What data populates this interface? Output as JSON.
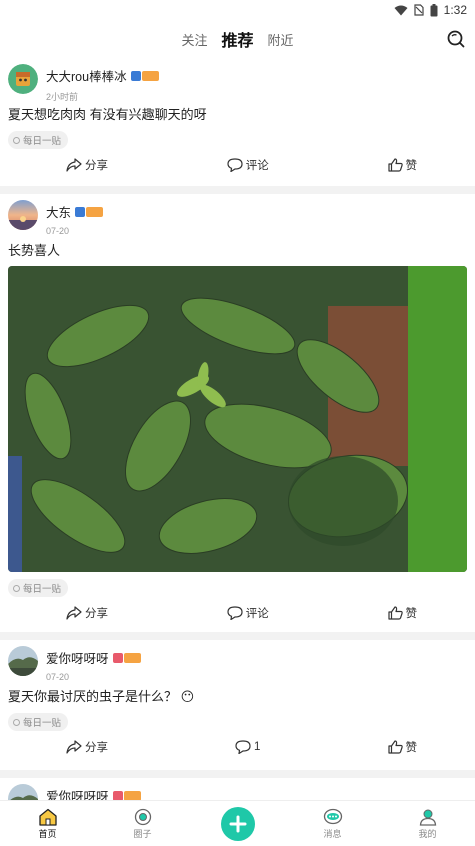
{
  "status_bar": {
    "time": "1:32"
  },
  "top_nav": {
    "tabs": [
      {
        "label": "关注"
      },
      {
        "label": "推荐"
      },
      {
        "label": "附近"
      }
    ]
  },
  "posts": [
    {
      "username": "大大rou棒棒冰",
      "time": "2小时前",
      "text": "夏天想吃肉肉 有没有兴趣聊天的呀",
      "tag": "每日一贴",
      "share": "分享",
      "comment": "评论",
      "like": "赞"
    },
    {
      "username": "大东",
      "time": "07-20",
      "text": "长势喜人",
      "tag": "每日一贴",
      "share": "分享",
      "comment": "评论",
      "like": "赞"
    },
    {
      "username": "爱你呀呀呀",
      "time": "07-20",
      "text": "夏天你最讨厌的虫子是什么？ 😶",
      "tag": "每日一贴",
      "share": "分享",
      "comment": "1",
      "like": "赞"
    },
    {
      "username": "爱你呀呀呀"
    }
  ],
  "bottom_nav": [
    {
      "label": "首页",
      "icon": "home-icon"
    },
    {
      "label": "圈子",
      "icon": "circle-icon"
    },
    {
      "label": "",
      "icon": "plus-icon"
    },
    {
      "label": "消息",
      "icon": "message-icon"
    },
    {
      "label": "我的",
      "icon": "profile-icon"
    }
  ],
  "colors": {
    "accent": "#1fc8a8",
    "vip_blue": "#3a7bd5",
    "vip_orange": "#f5a342",
    "vip_red": "#e85a6b"
  }
}
